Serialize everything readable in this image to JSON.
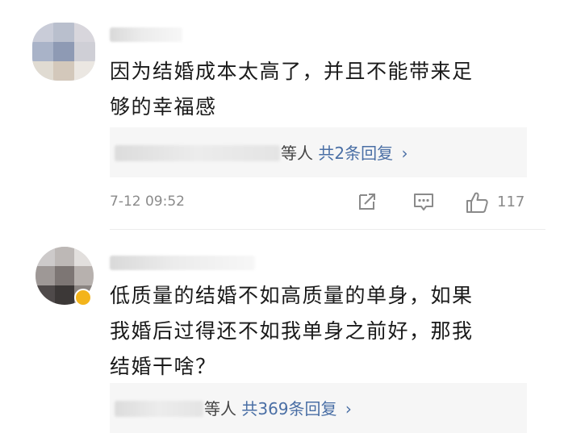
{
  "comments": [
    {
      "username": "",
      "text": [
        "因为结婚成本太高了，并且不能带来足",
        "够的幸福感"
      ],
      "reply": {
        "names_suffix": "等人",
        "summary": "共2条回复",
        "chevron": "›"
      },
      "timestamp": "7-12 09:52",
      "likes": "117",
      "icons": [
        "share-icon",
        "comment-icon",
        "like-icon"
      ]
    },
    {
      "username": "",
      "text": [
        "低质量的结婚不如高质量的单身，如果",
        "我婚后过得还不如我单身之前好，那我",
        "结婚干啥？"
      ],
      "reply": {
        "names_suffix": "等人",
        "summary": "共369条回复",
        "chevron": "›"
      }
    }
  ],
  "colors": {
    "reply_link": "#4a6fa5",
    "meta_gray": "#8a8a8a",
    "reply_bg": "#f6f6f6"
  }
}
